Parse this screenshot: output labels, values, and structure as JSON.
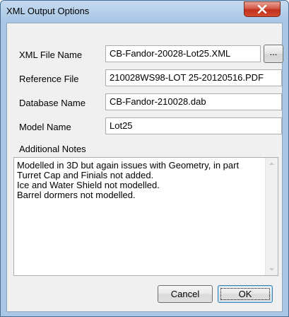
{
  "window": {
    "title": "XML Output Options"
  },
  "fields": {
    "xml_file_name": {
      "label": "XML File Name",
      "value": "CB-Fandor-20028-Lot25.XML"
    },
    "reference_file": {
      "label": "Reference File",
      "value": "210028WS98-LOT 25-20120516.PDF"
    },
    "database_name": {
      "label": "Database Name",
      "value": "CB-Fandor-210028.dab"
    },
    "model_name": {
      "label": "Model Name",
      "value": "Lot25"
    }
  },
  "browse_label": "...",
  "notes": {
    "label": "Additional Notes",
    "lines": [
      "Modelled in 3D but again issues with Geometry, in part",
      "Turret Cap and Finials not added.",
      "Ice and Water Shield not modelled.",
      "Barrel dormers not modelled."
    ]
  },
  "buttons": {
    "cancel": "Cancel",
    "ok": "OK"
  },
  "icons": {
    "close": "close-icon",
    "scroll_up": "arrow-up-icon",
    "scroll_down": "arrow-down-icon"
  },
  "colors": {
    "titlebar": "#a9c6e5",
    "close_button": "#c0301c",
    "dialog_bg": "#f0f0f0"
  }
}
